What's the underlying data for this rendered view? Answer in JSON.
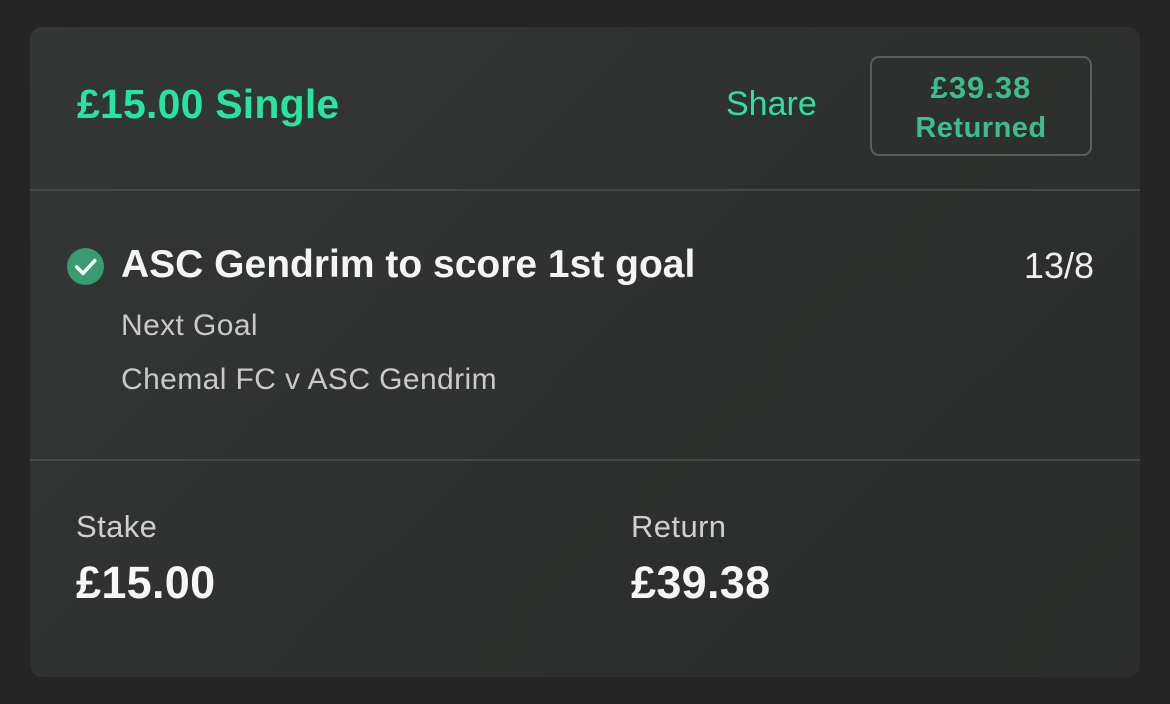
{
  "header": {
    "title": "£15.00 Single",
    "share_label": "Share",
    "returned_amount": "£39.38",
    "returned_label": "Returned"
  },
  "selection": {
    "status_icon": "check-circle-icon",
    "name": "ASC Gendrim to score 1st goal",
    "odds": "13/8",
    "market": "Next Goal",
    "event": "Chemal FC v ASC Gendrim"
  },
  "summary": {
    "stake_label": "Stake",
    "stake_value": "£15.00",
    "return_label": "Return",
    "return_value": "£39.38"
  },
  "colors": {
    "accent": "#25e5a0",
    "badge_text": "#3dbd8c",
    "check_fill": "#3a9a70",
    "card_bg": "#313432",
    "page_bg": "#252525"
  }
}
